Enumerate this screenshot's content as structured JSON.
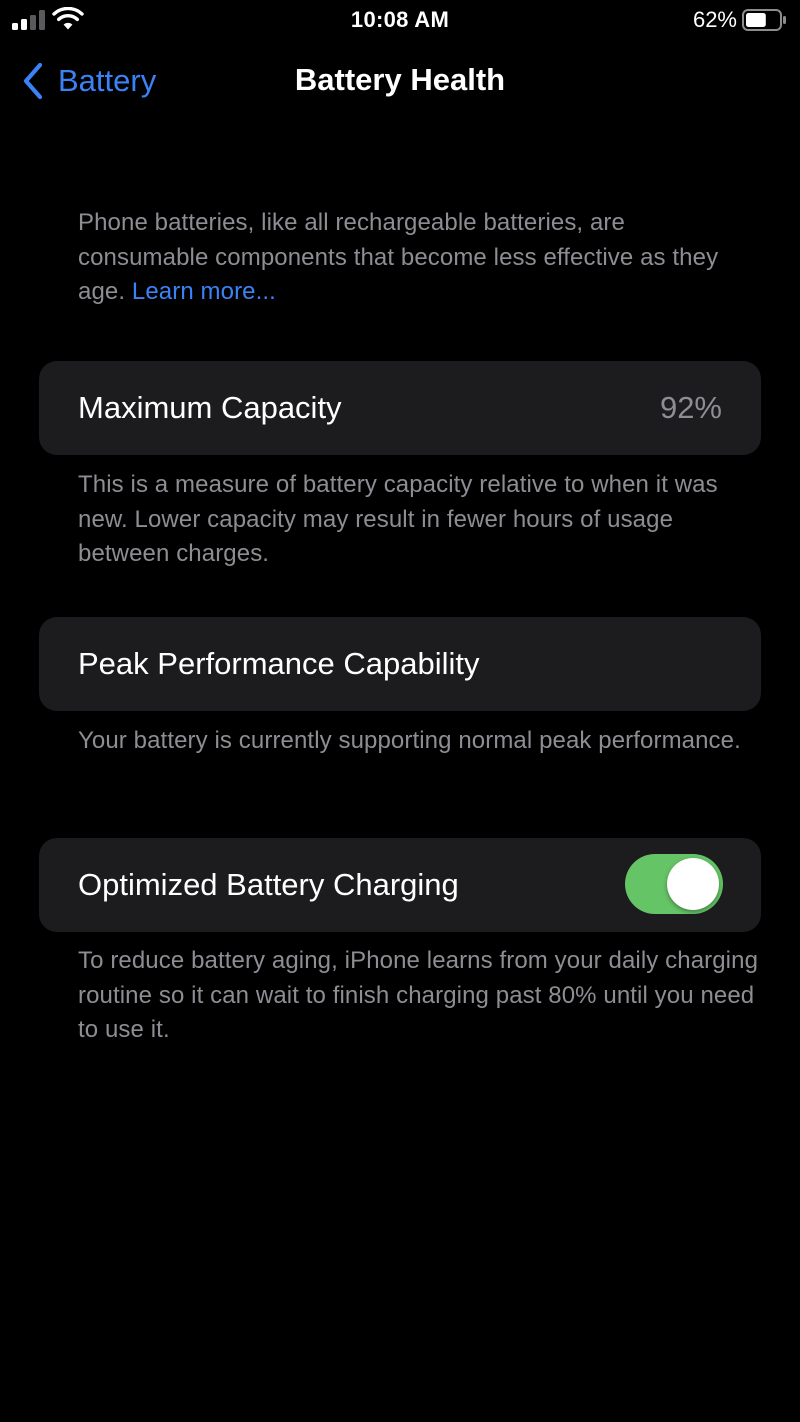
{
  "status_bar": {
    "time": "10:08 AM",
    "battery_percent": "62%",
    "battery_level": 0.62,
    "signal_bars_active": 2,
    "signal_bars_total": 4
  },
  "nav": {
    "back_label": "Battery",
    "title": "Battery Health"
  },
  "intro": {
    "text": "Phone batteries, like all rechargeable batteries, are consumable components that become less effective as they age. ",
    "link_label": "Learn more..."
  },
  "maximum_capacity": {
    "label": "Maximum Capacity",
    "value": "92%",
    "description": "This is a measure of battery capacity relative to when it was new. Lower capacity may result in fewer hours of usage between charges."
  },
  "peak_performance": {
    "label": "Peak Performance Capability",
    "description": "Your battery is currently supporting normal peak performance."
  },
  "optimized_charging": {
    "label": "Optimized Battery Charging",
    "enabled": true,
    "description": "To reduce battery aging, iPhone learns from your daily charging routine so it can wait to finish charging past 80% until you need to use it."
  },
  "icons": {
    "back": "chevron-left-icon",
    "signal": "cellular-signal-icon",
    "wifi": "wifi-icon",
    "battery": "battery-icon"
  },
  "colors": {
    "accent": "#3b82f6",
    "toggle_on": "#65c466",
    "signal_active": "#ffffff",
    "signal_inactive": "#5a5a5e",
    "background": "#000000",
    "card": "#1c1c1e",
    "secondary_text": "#8d8d93"
  }
}
